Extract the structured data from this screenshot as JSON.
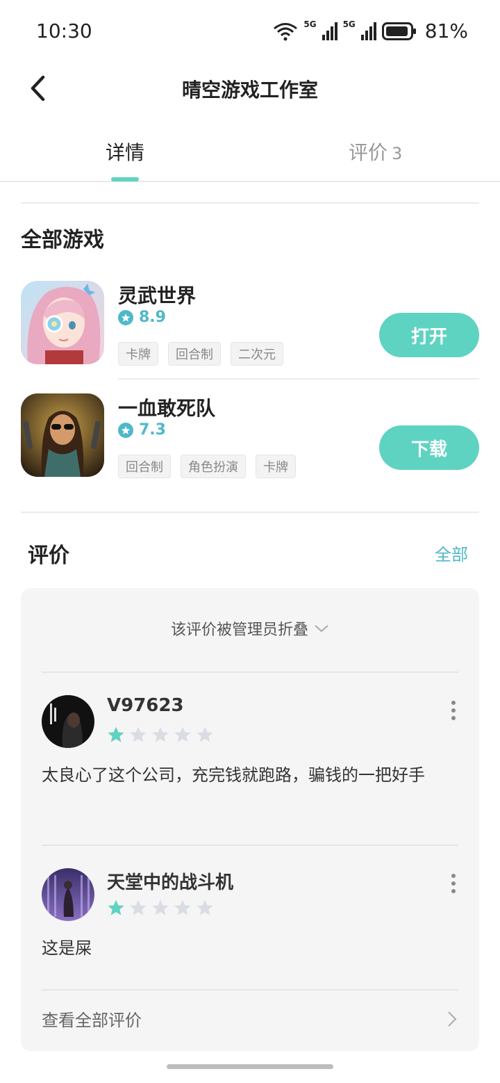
{
  "status_bar": {
    "time": "10:30",
    "battery": "81%",
    "net1": "5G",
    "net2": "5G"
  },
  "nav": {
    "title": "晴空游戏工作室"
  },
  "tabs": {
    "detail": "详情",
    "reviews": "评价",
    "reviews_count": "3"
  },
  "games_section": {
    "title": "全部游戏",
    "games": [
      {
        "name": "灵武世界",
        "rating": "8.9",
        "tags": [
          "卡牌",
          "回合制",
          "二次元"
        ],
        "button": "打开"
      },
      {
        "name": "一血敢死队",
        "rating": "7.3",
        "tags": [
          "回合制",
          "角色扮演",
          "卡牌"
        ],
        "button": "下载"
      }
    ]
  },
  "reviews_section": {
    "title": "评价",
    "all_link": "全部",
    "folded_notice": "该评价被管理员折叠",
    "reviews": [
      {
        "user": "V97623",
        "stars": 1,
        "text": "太良心了这个公司，充完钱就跑路，骗钱的一把好手"
      },
      {
        "user": "天堂中的战斗机",
        "stars": 1,
        "text": "这是屎"
      }
    ],
    "view_all": "查看全部评价"
  },
  "colors": {
    "accent": "#5fd3c2",
    "rating": "#4fb8c8",
    "star_empty": "#d9dde3"
  }
}
